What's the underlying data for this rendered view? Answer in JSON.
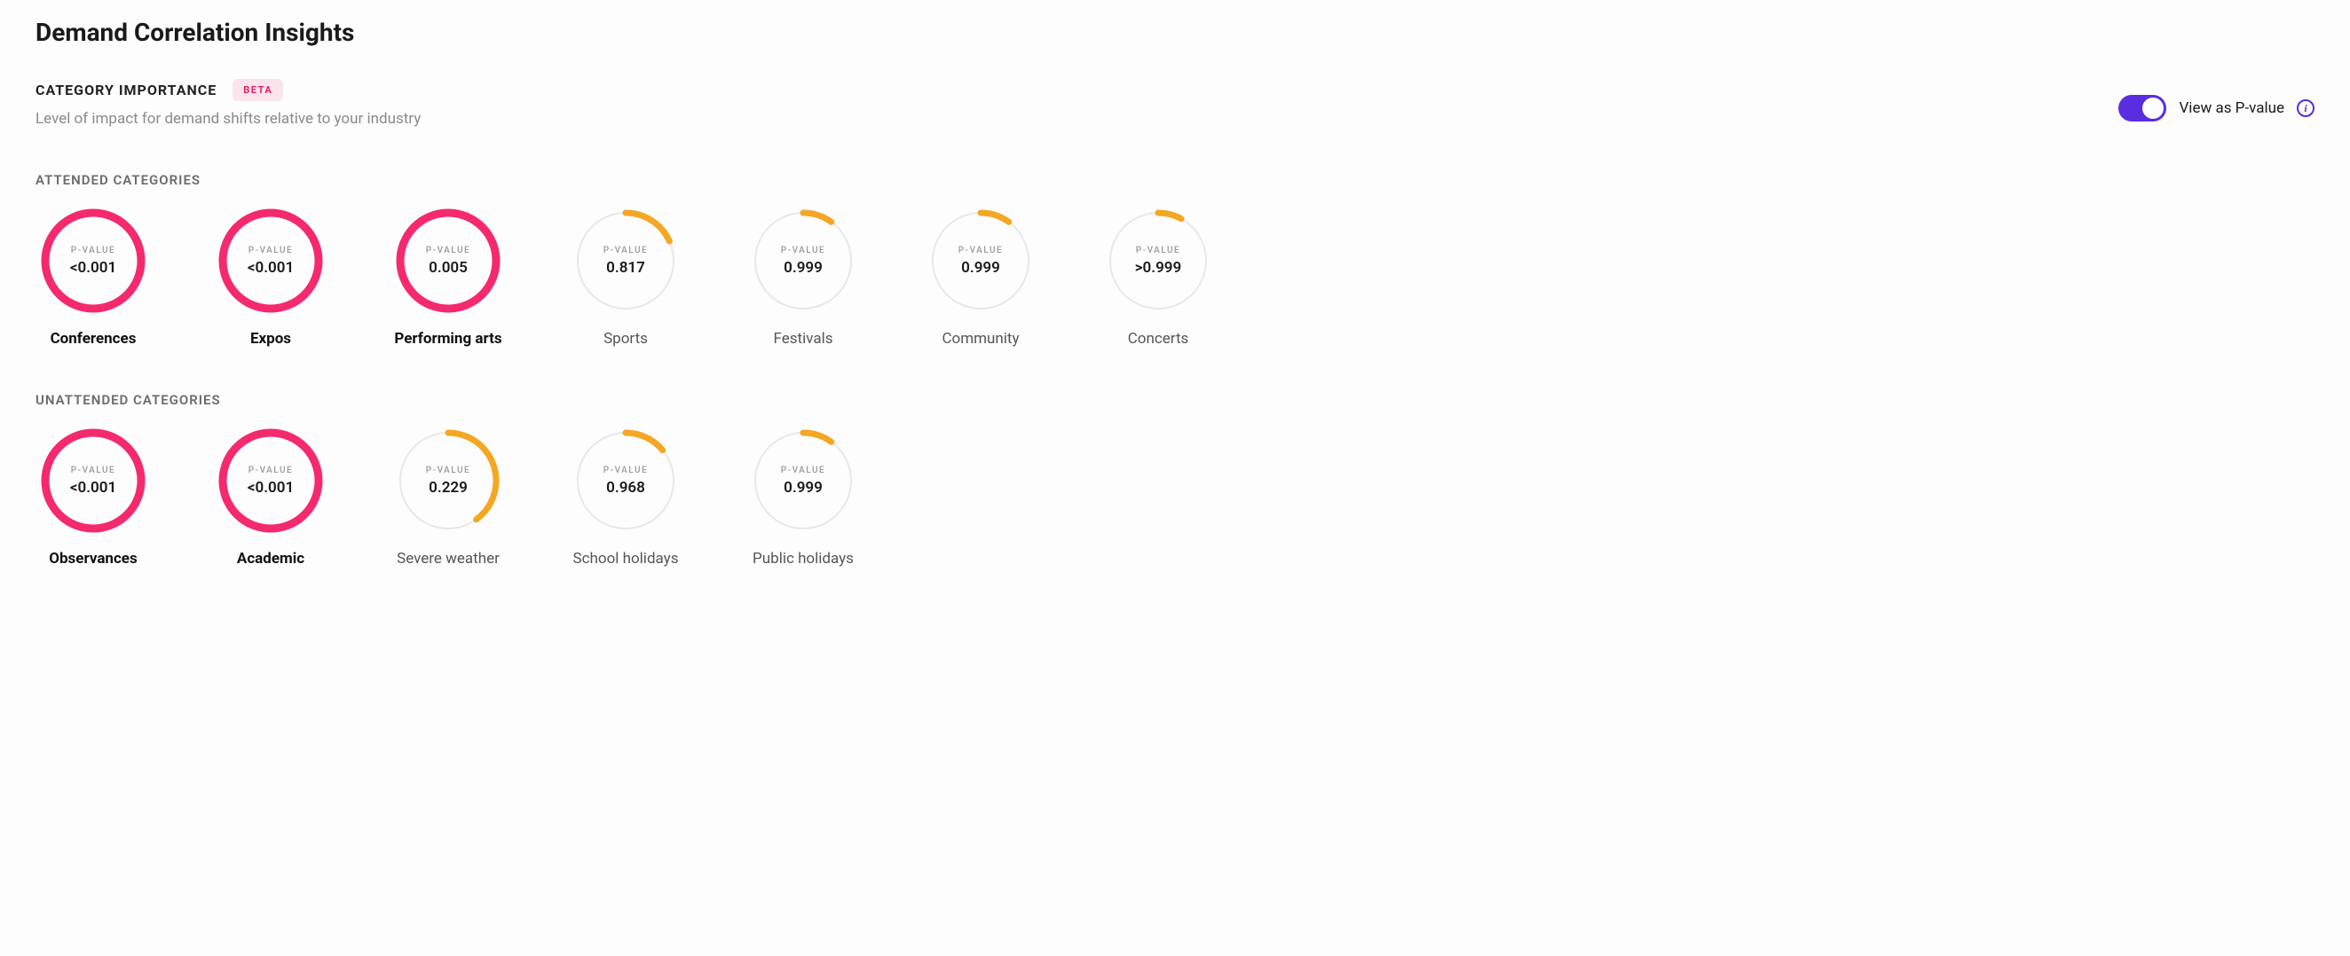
{
  "page": {
    "title": "Demand Correlation Insights"
  },
  "category_importance": {
    "title": "CATEGORY IMPORTANCE",
    "badge": "BETA",
    "subtitle": "Level of impact for demand shifts relative to your industry",
    "toggle_label": "View as P-value",
    "toggle_on": true
  },
  "colors": {
    "significant": "#f5296e",
    "weak": "#f5a623",
    "track": "#e8e8e8",
    "toggle": "#5b2de0"
  },
  "pvalue_label": "P-VALUE",
  "groups": [
    {
      "title": "ATTENDED CATEGORIES",
      "items": [
        {
          "label": "Conferences",
          "value": "<0.001",
          "fill": 1.0,
          "significant": true
        },
        {
          "label": "Expos",
          "value": "<0.001",
          "fill": 1.0,
          "significant": true
        },
        {
          "label": "Performing arts",
          "value": "0.005",
          "fill": 0.995,
          "significant": true
        },
        {
          "label": "Sports",
          "value": "0.817",
          "fill": 0.183,
          "significant": false
        },
        {
          "label": "Festivals",
          "value": "0.999",
          "fill": 0.1,
          "significant": false
        },
        {
          "label": "Community",
          "value": "0.999",
          "fill": 0.1,
          "significant": false
        },
        {
          "label": "Concerts",
          "value": ">0.999",
          "fill": 0.08,
          "significant": false
        }
      ]
    },
    {
      "title": "UNATTENDED CATEGORIES",
      "items": [
        {
          "label": "Observances",
          "value": "<0.001",
          "fill": 1.0,
          "significant": true
        },
        {
          "label": "Academic",
          "value": "<0.001",
          "fill": 1.0,
          "significant": true
        },
        {
          "label": "Severe weather",
          "value": "0.229",
          "fill": 0.4,
          "significant": false
        },
        {
          "label": "School holidays",
          "value": "0.968",
          "fill": 0.14,
          "significant": false
        },
        {
          "label": "Public holidays",
          "value": "0.999",
          "fill": 0.1,
          "significant": false
        }
      ]
    }
  ]
}
